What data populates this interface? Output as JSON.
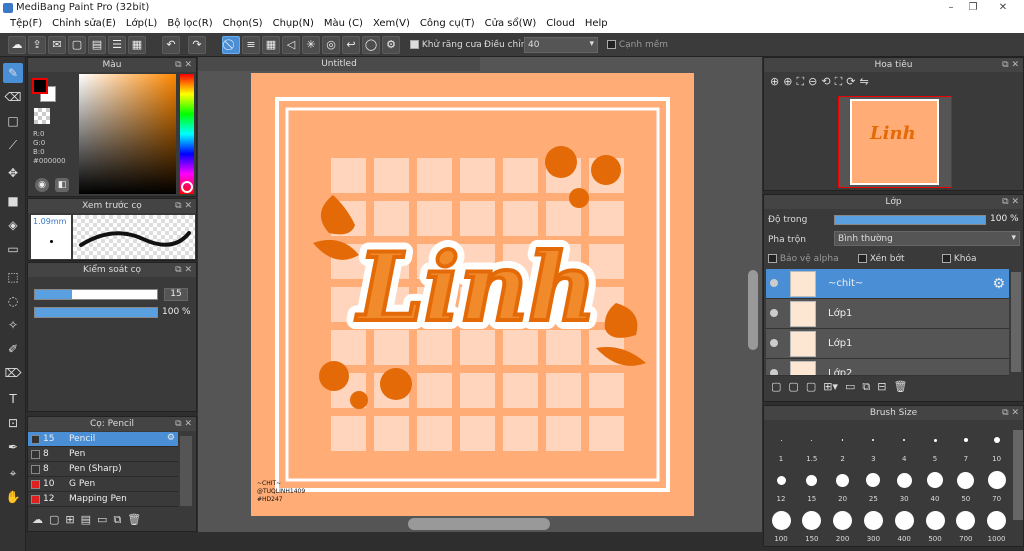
{
  "window": {
    "title": "MediBang Paint Pro (32bit)"
  },
  "menu": [
    "Tệp(F)",
    "Chỉnh sửa(E)",
    "Lớp(L)",
    "Bộ lọc(R)",
    "Chọn(S)",
    "Chụp(N)",
    "Màu (C)",
    "Xem(V)",
    "Công cụ(T)",
    "Cửa sổ(W)",
    "Cloud",
    "Help"
  ],
  "toolbar": {
    "antialias_label": "Khử răng cưa",
    "adjust_label": "Điều chỉnh",
    "adjust_value": "40",
    "smooth_edge_label": "Cạnh mềm"
  },
  "color_panel": {
    "title": "Màu",
    "r": "R:0",
    "g": "G:0",
    "b": "B:0",
    "hex": "#000000"
  },
  "brush_preview": {
    "title": "Xem trước cọ",
    "size": "1.09mm"
  },
  "brush_control": {
    "title": "Kiểm soát cọ",
    "size_value": "15",
    "opacity_value": "100 %",
    "size_fraction": 0.3,
    "opacity_fraction": 1.0
  },
  "brush_list": {
    "title": "Cọ: Pencil",
    "items": [
      {
        "num": "15",
        "name": "Pencil",
        "color": "#333333",
        "selected": true
      },
      {
        "num": "8",
        "name": "Pen",
        "color": "#333333",
        "selected": false
      },
      {
        "num": "8",
        "name": "Pen (Sharp)",
        "color": "#333333",
        "selected": false
      },
      {
        "num": "10",
        "name": "G Pen",
        "color": "#e02020",
        "selected": false
      },
      {
        "num": "12",
        "name": "Mapping Pen",
        "color": "#e02020",
        "selected": false
      }
    ]
  },
  "document": {
    "tab": "Untitled"
  },
  "artwork": {
    "title_text": "Linh",
    "credit_lines": [
      "~CHIT~",
      "@TUQLINH1409",
      "#HD247"
    ],
    "bg_color": "#ffac77",
    "grid_color": "#ffd6bd",
    "accent_color": "#e46a08"
  },
  "navigator": {
    "title": "Hoa tiêu"
  },
  "layer_panel": {
    "title": "Lớp",
    "opacity_label": "Độ trong",
    "opacity_value": "100 %",
    "blend_label": "Pha trộn",
    "blend_value": "Bình thường",
    "protect_alpha_label": "Bảo vệ alpha",
    "clip_label": "Xén bớt",
    "lock_label": "Khóa",
    "layers": [
      {
        "name": "~chit~",
        "selected": true
      },
      {
        "name": "Lớp1",
        "selected": false
      },
      {
        "name": "Lớp1",
        "selected": false
      },
      {
        "name": "Lớp2",
        "selected": false
      }
    ]
  },
  "brush_size": {
    "title": "Brush Size",
    "sizes": [
      "1",
      "1.5",
      "2",
      "3",
      "4",
      "5",
      "7",
      "10",
      "12",
      "15",
      "20",
      "25",
      "30",
      "40",
      "50",
      "70",
      "100",
      "150",
      "200",
      "300",
      "400",
      "500",
      "700",
      "1000"
    ]
  }
}
